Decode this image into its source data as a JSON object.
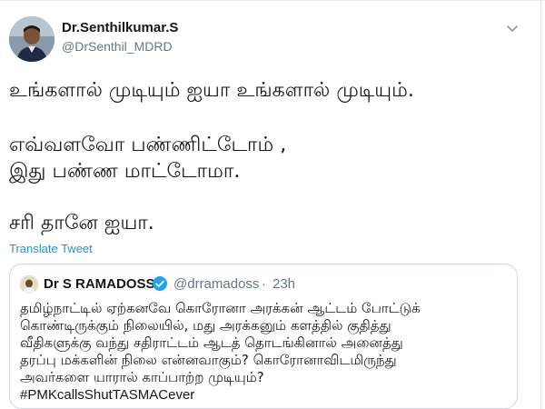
{
  "author": {
    "name": "Dr.Senthilkumar.S",
    "handle": "@DrSenthil_MDRD"
  },
  "tweet": {
    "lines": [
      "உங்களால் முடியும் ஐயா உங்களால் முடியும்.",
      "எவ்வளவோ பண்ணிட்டோம் ,",
      "இது பண்ண மாட்டோமா.",
      "சரி  தானே ஐயா."
    ],
    "translate_label": "Translate Tweet"
  },
  "quoted_tweet": {
    "name": "Dr S RAMADOSS",
    "handle": "@drramadoss",
    "dot": "·",
    "time": "23h",
    "lines": [
      "தமிழ்நாட்டில் ஏற்கனவே கொரோனா அரக்கன் ஆட்டம் போட்டுக்",
      "கொண்டிருக்கும் நிலையில், மது அரக்கனும் களத்தில் குதித்து",
      "வீதிகளுக்கு வந்து சதிராட்டம் ஆடத் தொடங்கினால் அனைத்து",
      "தரப்பு மக்களின் நிலை என்னவாகும்? கொரோனாவிடமிருந்து",
      "அவர்களை யாரால் காப்பாற்ற முடியும்?",
      "#PMKcallsShutTASMACever"
    ]
  },
  "icons": {
    "caret": "chevron-down-icon",
    "verified": "verified-badge-icon"
  },
  "colors": {
    "link": "#1b95e0",
    "secondary_text": "#657786",
    "primary_text": "#14171a",
    "verified": "#1da1f2",
    "border": "#ccd6dd"
  }
}
